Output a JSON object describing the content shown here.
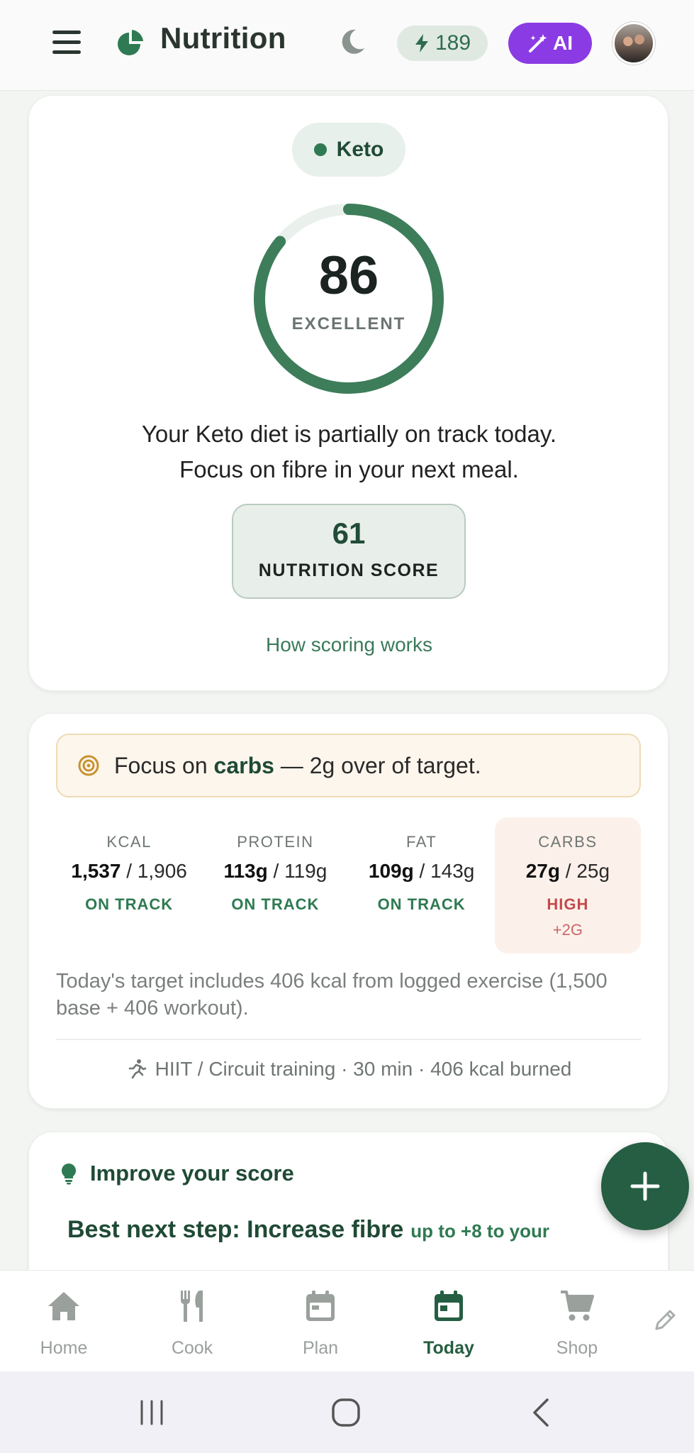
{
  "header": {
    "title": "Nutrition",
    "credits": "189",
    "ai_label": "AI"
  },
  "score_card": {
    "diet": "Keto",
    "score": "86",
    "score_fraction": 0.86,
    "score_label": "EXCELLENT",
    "summary_line1": "Your Keto diet is partially on track today.",
    "summary_line2": "Focus on fibre in your next meal.",
    "nutrition_score_value": "61",
    "nutrition_score_label": "NUTRITION SCORE",
    "how_link": "How scoring works"
  },
  "macro_card": {
    "focus_prefix": "Focus on",
    "focus_nutrient": "carbs",
    "focus_suffix": "— 2g over of target.",
    "macros": [
      {
        "name": "KCAL",
        "value": "1,537",
        "target": "1,906",
        "status": "ON TRACK",
        "delta": ""
      },
      {
        "name": "PROTEIN",
        "value": "113g",
        "target": "119g",
        "status": "ON TRACK",
        "delta": ""
      },
      {
        "name": "FAT",
        "value": "109g",
        "target": "143g",
        "status": "ON TRACK",
        "delta": ""
      },
      {
        "name": "CARBS",
        "value": "27g",
        "target": "25g",
        "status": "HIGH",
        "delta": "+2G"
      }
    ],
    "target_note": "Today's target includes 406 kcal from logged exercise (1,500 base + 406 workout).",
    "exercise": "HIIT / Circuit training · 30 min · 406 kcal burned"
  },
  "improve_card": {
    "title": "Improve your score",
    "next_step": "Best next step: Increase fibre",
    "next_step_hint": "up to +8 to your"
  },
  "nav": {
    "items": [
      {
        "label": "Home",
        "icon": "home-icon"
      },
      {
        "label": "Cook",
        "icon": "fork-knife-icon"
      },
      {
        "label": "Plan",
        "icon": "calendar-icon"
      },
      {
        "label": "Today",
        "icon": "calendar-today-icon"
      },
      {
        "label": "Shop",
        "icon": "cart-icon"
      }
    ],
    "active": "Today"
  },
  "colors": {
    "brand_green": "#255e42",
    "ai_purple": "#8b3be3",
    "warning_red": "#c44a4a"
  }
}
